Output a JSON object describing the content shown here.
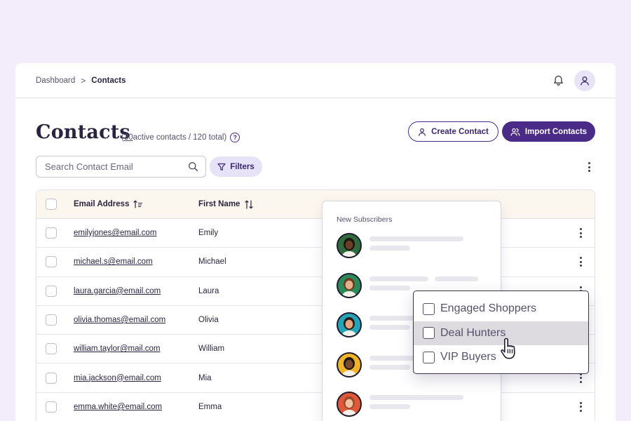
{
  "breadcrumb": {
    "root": "Dashboard",
    "separator": ">",
    "current": "Contacts"
  },
  "header": {
    "bell_icon": "bell-icon",
    "profile_icon": "user-icon"
  },
  "page": {
    "title": "Contacts",
    "count_open": "(",
    "active_count": "30",
    "active_suffix": " active contacts / 120 total)",
    "help_glyph": "?"
  },
  "actions": {
    "create_label": "Create Contact",
    "import_label": "Import Contacts"
  },
  "search": {
    "placeholder": "Search Contact Email",
    "value": ""
  },
  "filters": {
    "label": "Filters"
  },
  "table": {
    "columns": {
      "email": "Email Address",
      "first_name": "First Name"
    },
    "rows": [
      {
        "email": "emilyjones@email.com",
        "first_name": "Emily"
      },
      {
        "email": "michael.s@email.com",
        "first_name": "Michael"
      },
      {
        "email": "laura.garcia@email.com",
        "first_name": "Laura"
      },
      {
        "email": "olivia.thomas@email.com",
        "first_name": "Olivia"
      },
      {
        "email": "william.taylor@mail.com",
        "first_name": "William"
      },
      {
        "email": "mia.jackson@email.com",
        "first_name": "Mia"
      },
      {
        "email": "emma.white@email.com",
        "first_name": "Emma"
      }
    ]
  },
  "subscribers_panel": {
    "title": "New Subscribers"
  },
  "groups_panel": {
    "items": [
      {
        "label": "Engaged Shoppers",
        "checked": false
      },
      {
        "label": "Deal Hunters",
        "checked": false,
        "hovered": true
      },
      {
        "label": "VIP Buyers",
        "checked": false
      }
    ]
  },
  "colors": {
    "accent": "#4a2b88",
    "background": "#f2ecfb",
    "header_row": "#fcf7ee",
    "filter_bg": "#e6e2f7"
  }
}
